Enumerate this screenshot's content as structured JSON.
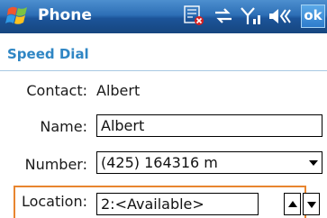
{
  "titlebar": {
    "title": "Phone",
    "ok_label": "ok",
    "icons": [
      "start-logo-icon",
      "call-forward-icon",
      "connectivity-icon",
      "signal-strength-icon",
      "volume-icon"
    ]
  },
  "section": {
    "title": "Speed Dial"
  },
  "form": {
    "contact": {
      "label": "Contact:",
      "value": "Albert"
    },
    "name": {
      "label": "Name:",
      "value": "Albert"
    },
    "number": {
      "label": "Number:",
      "value": "(425) 164316 m"
    },
    "location": {
      "label": "Location:",
      "value": "2:<Available>"
    }
  },
  "colors": {
    "titlebar": "#2d6fb6",
    "section_title": "#2f86c4",
    "focus": "#e8852f"
  }
}
